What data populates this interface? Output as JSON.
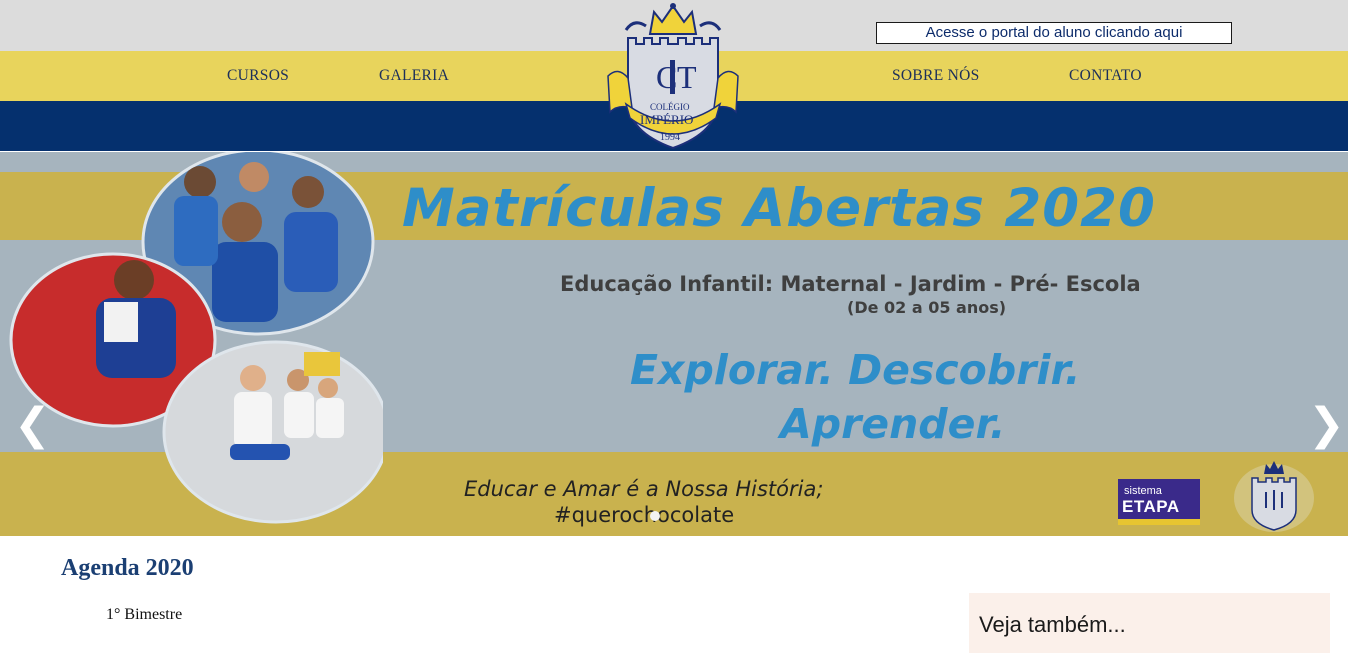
{
  "header": {
    "portal_link": "Acesse o portal do aluno clicando aqui",
    "nav": {
      "cursos": "CURSOS",
      "galeria": "GALERIA",
      "sobre": "SOBRE NÓS",
      "contato": "CONTATO"
    },
    "logo": {
      "initials_left": "C",
      "initials_right": "T",
      "ribbon_small": "COLÉGIO",
      "ribbon_large": "IMPÉRIO",
      "year": "1994"
    }
  },
  "banner": {
    "headline": "Matrículas Abertas 2020",
    "subtitle": "Educação Infantil: Maternal - Jardim - Pré- Escola",
    "ages": "(De 02 a 05 anos)",
    "motto_line1": "Explorar. Descobrir.",
    "motto_line2": "Aprender.",
    "slogan_line1": "Educar e Amar é a Nossa História;",
    "slogan_line2": "#querochocolate",
    "etapa_small": "sistema",
    "etapa_big": "ETAPA",
    "prev_arrow": "❮",
    "next_arrow": "❯"
  },
  "main": {
    "agenda_title": "Agenda 2020",
    "bimestre": "1° Bimestre"
  },
  "sidebar": {
    "title": "Veja também..."
  },
  "colors": {
    "top_gray": "#dcdcdc",
    "nav_yellow": "#e8d45c",
    "navy": "#05306e",
    "banner_blue_text": "#2e8ec9",
    "banner_band_gold": "#c9b24e"
  }
}
